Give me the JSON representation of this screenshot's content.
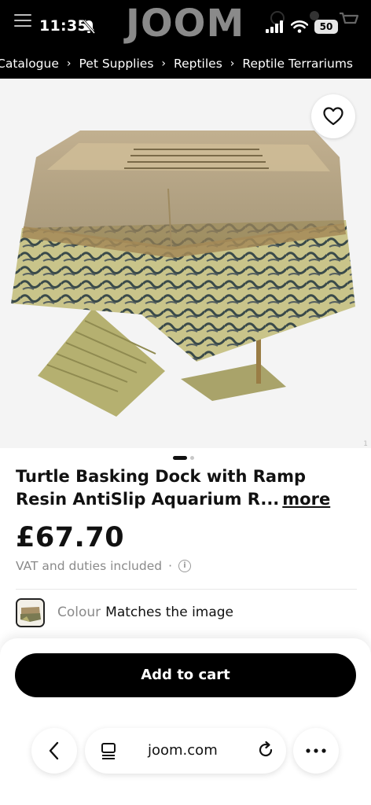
{
  "status_bar": {
    "time": "11:35",
    "battery": "50",
    "brand": "JOOM"
  },
  "breadcrumb": [
    "Catalogue",
    "Pet Supplies",
    "Reptiles",
    "Reptile Terrariums"
  ],
  "product": {
    "image_counter": "1",
    "title": "Turtle Basking Dock with Ramp Resin AntiSlip Aquarium R...",
    "more_label": "more",
    "price": "£67.70",
    "vat_text": "VAT and duties included",
    "vat_separator": "·",
    "info_glyph": "i",
    "colour_label": "Colour",
    "colour_value": "Matches the image"
  },
  "actions": {
    "add_to_cart": "Add to cart"
  },
  "browser": {
    "url": "joom.com"
  },
  "icons": {
    "menu": "hamburger-icon",
    "notifications_muted": "bell-off-icon",
    "favorite": "heart-icon",
    "info": "info-icon",
    "back": "chevron-left-icon",
    "tabs": "tabs-icon",
    "reload": "reload-icon",
    "more": "ellipsis-icon"
  },
  "colors": {
    "header_bg": "#000000",
    "primary_button": "#000000",
    "muted_text": "#8a8a8a"
  }
}
